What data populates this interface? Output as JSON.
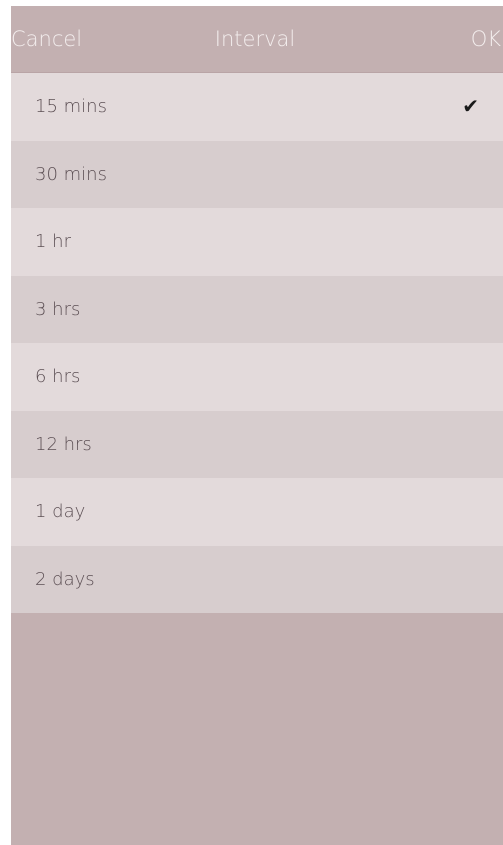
{
  "navbar": {
    "cancel_label": "Cancel",
    "title": "Interval",
    "ok_label": "OK"
  },
  "options": [
    {
      "label": "15 mins",
      "selected": true
    },
    {
      "label": "30 mins",
      "selected": false
    },
    {
      "label": "1 hr",
      "selected": false
    },
    {
      "label": "3 hrs",
      "selected": false
    },
    {
      "label": "6 hrs",
      "selected": false
    },
    {
      "label": "12 hrs",
      "selected": false
    },
    {
      "label": "1 day",
      "selected": false
    },
    {
      "label": "2 days",
      "selected": false
    }
  ],
  "icons": {
    "selected": "checkmark-icon"
  },
  "colors": {
    "background": "#c3b0b1",
    "row_light": "#e3dadb",
    "row_dark": "#d7cdce",
    "nav_text": "#f3eded",
    "row_text": "#5d5055"
  }
}
